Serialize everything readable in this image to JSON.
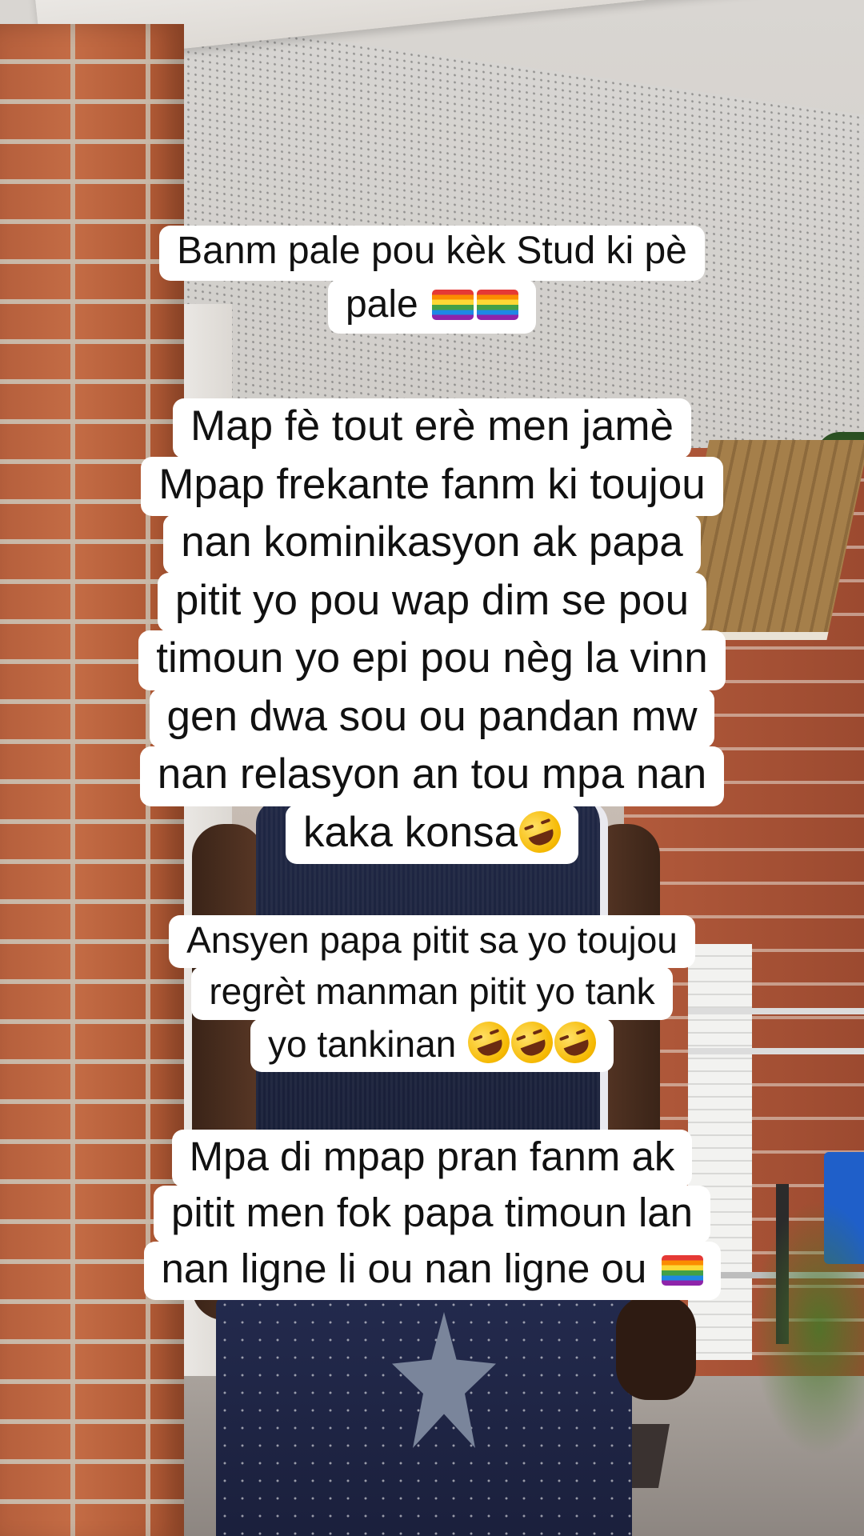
{
  "captions": [
    {
      "lines": [
        "Banm pale pou kèk Stud ki pè",
        "pale"
      ],
      "trailing_emoji": [
        "rainbow-flag",
        "rainbow-flag"
      ]
    },
    {
      "lines": [
        "Map fè tout erè men jamè",
        "Mpap frekante fanm ki toujou",
        "nan kominikasyon ak papa",
        "pitit yo pou wap dim se pou",
        "timoun yo epi pou nèg la vinn",
        "gen dwa sou ou pandan mw",
        "nan relasyon an tou mpa nan",
        "kaka konsa"
      ],
      "trailing_emoji": [
        "rolling-laughing"
      ]
    },
    {
      "lines": [
        "Ansyen papa pitit sa yo toujou",
        "regrèt manman pitit yo tank",
        "yo tankinan"
      ],
      "trailing_emoji": [
        "rolling-laughing",
        "rolling-laughing",
        "rolling-laughing"
      ]
    },
    {
      "lines": [
        "Mpa di mpap pran fanm ak",
        "pitit men fok papa timoun lan",
        "nan ligne li ou nan ligne ou"
      ],
      "trailing_emoji": [
        "rainbow-flag"
      ]
    }
  ],
  "colors": {
    "caption_background": "#ffffff",
    "caption_text": "#111111"
  }
}
